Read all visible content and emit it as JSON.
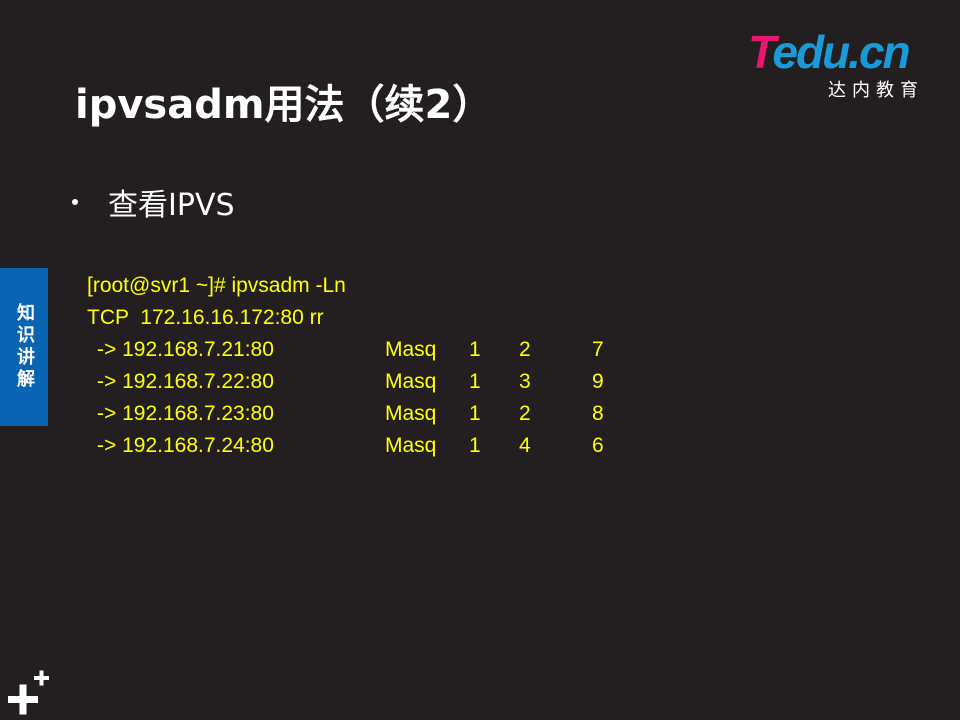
{
  "slide": {
    "title": "ipvsadm用法（续2）",
    "bullet": "查看IPVS",
    "side_tab": "知识讲解"
  },
  "logo": {
    "first_letter": "T",
    "rest": "edu.cn",
    "subtitle": "达内教育",
    "colors": {
      "accent_pink": "#e8176f",
      "accent_blue": "#1a9bd7"
    }
  },
  "terminal": {
    "command_line": "[root@svr1 ~]# ipvsadm -Ln",
    "service_line": "TCP  172.16.16.172:80 rr",
    "rows": [
      {
        "addr": "-> 192.168.7.21:80",
        "mode": "Masq",
        "weight": "1",
        "active": "2",
        "inactive": "7"
      },
      {
        "addr": "-> 192.168.7.22:80",
        "mode": "Masq",
        "weight": "1",
        "active": "3",
        "inactive": "9"
      },
      {
        "addr": "-> 192.168.7.23:80",
        "mode": "Masq",
        "weight": "1",
        "active": "2",
        "inactive": "8"
      },
      {
        "addr": "-> 192.168.7.24:80",
        "mode": "Masq",
        "weight": "1",
        "active": "4",
        "inactive": "6"
      }
    ],
    "text_color": "#ffff00"
  },
  "colors": {
    "background": "#231f20",
    "side_tab": "#0a64b4"
  },
  "icons": {
    "corner": "plus-plus-icon"
  }
}
